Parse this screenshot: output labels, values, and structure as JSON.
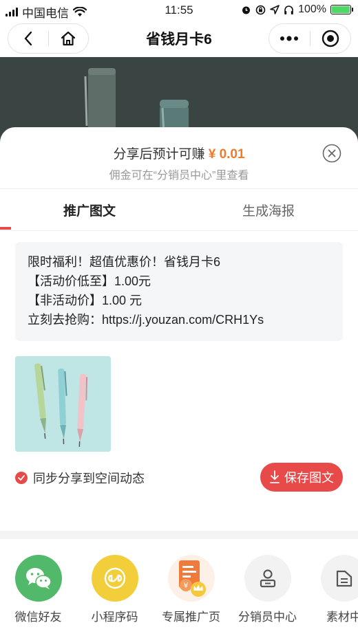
{
  "status_bar": {
    "carrier": "中国电信",
    "time": "11:55",
    "battery": "100%",
    "icons": [
      "signal-icon",
      "wifi-icon",
      "alarm-icon",
      "orientation-lock-icon",
      "location-icon",
      "headphones-icon",
      "battery-icon"
    ]
  },
  "navbar": {
    "title": "省钱月卡6",
    "left_icons": [
      "back-icon",
      "home-icon"
    ],
    "right_icons": [
      "more-icon",
      "target-icon"
    ]
  },
  "share_sheet": {
    "earn_prefix": "分享后预计可赚",
    "earn_amount": "¥ 0.01",
    "earn_sub": "佣金可在“分销员中心”里查看",
    "tabs": [
      "推广图文",
      "生成海报"
    ],
    "active_tab": 0,
    "copy_lines": [
      "限时福利！超值优惠价！省钱月卡6",
      "【活动价低至】1.00元",
      "【非活动价】1.00 元",
      "立刻去抢购：https://j.youzan.com/CRH1Ys"
    ],
    "sync_label": "同步分享到空间动态",
    "sync_checked": true,
    "save_label": "保存图文",
    "share_options": [
      {
        "label": "微信好友",
        "icon": "wechat-icon",
        "color": "#52b96a"
      },
      {
        "label": "小程序码",
        "icon": "miniprogram-code-icon",
        "color": "#f2cf3a"
      },
      {
        "label": "专属推广页",
        "icon": "promo-page-icon",
        "color": "#fdf0e6"
      },
      {
        "label": "分销员中心",
        "icon": "distributor-center-icon",
        "color": "#f2f2f2"
      },
      {
        "label": "素材中",
        "icon": "materials-icon",
        "color": "#f2f2f2"
      }
    ]
  },
  "colors": {
    "accent_red": "#e84a4a",
    "earn_orange": "#ee7a2e"
  }
}
